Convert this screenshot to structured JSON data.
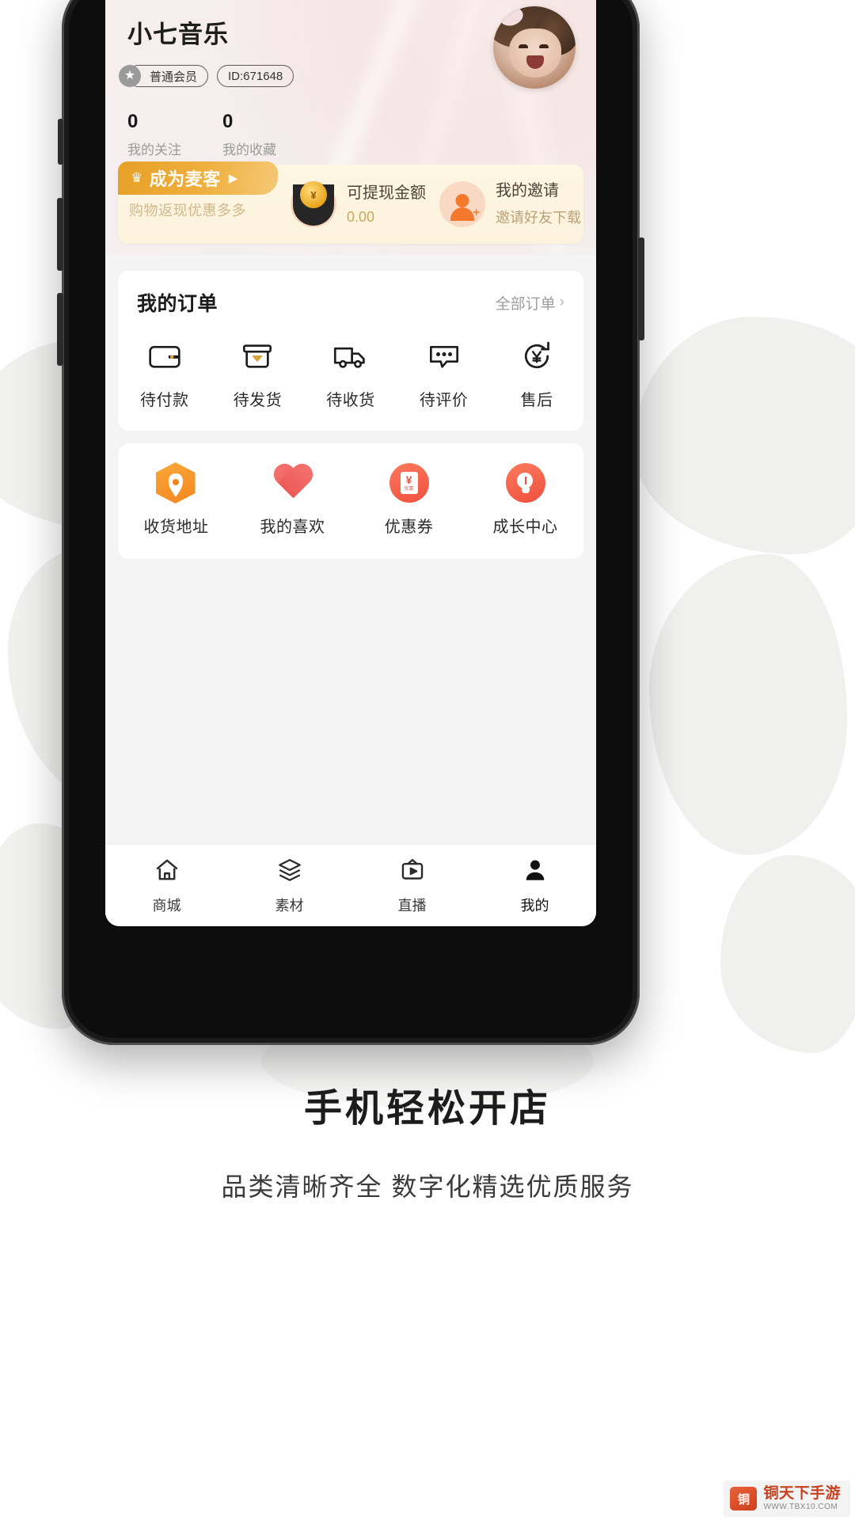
{
  "header": {
    "username": "小七音乐",
    "vip_badge": "普通会员",
    "id_badge": "ID:671648",
    "stats": [
      {
        "value": "0",
        "label": "我的关注"
      },
      {
        "value": "0",
        "label": "我的收藏"
      }
    ]
  },
  "promo": {
    "tag_label": "成为麦客",
    "tag_arrow": "▶",
    "subtitle": "购物返现优惠多多",
    "cells": [
      {
        "title": "可提现金额",
        "value": "0.00"
      },
      {
        "title": "我的邀请",
        "value": "邀请好友下载"
      }
    ]
  },
  "orders": {
    "title": "我的订单",
    "more_label": "全部订单",
    "more_chevron": "›",
    "items": [
      {
        "label": "待付款",
        "icon": "wallet-icon"
      },
      {
        "label": "待发货",
        "icon": "package-icon"
      },
      {
        "label": "待收货",
        "icon": "truck-icon"
      },
      {
        "label": "待评价",
        "icon": "comment-icon"
      },
      {
        "label": "售后",
        "icon": "refund-icon"
      }
    ]
  },
  "tools": {
    "items": [
      {
        "label": "收货地址",
        "icon": "location-pin-icon"
      },
      {
        "label": "我的喜欢",
        "icon": "heart-icon"
      },
      {
        "label": "优惠券",
        "icon": "coupon-icon",
        "note_symbol": "¥",
        "note_text": "优惠"
      },
      {
        "label": "成长中心",
        "icon": "lightbulb-icon"
      }
    ]
  },
  "tabbar": {
    "items": [
      {
        "label": "商城",
        "icon": "home-icon",
        "active": false
      },
      {
        "label": "素材",
        "icon": "layers-icon",
        "active": false
      },
      {
        "label": "直播",
        "icon": "live-tv-icon",
        "active": false
      },
      {
        "label": "我的",
        "icon": "person-icon",
        "active": true
      }
    ]
  },
  "footer": {
    "title": "手机轻松开店",
    "subtitle": "品类清晰齐全 数字化精选优质服务"
  },
  "watermark": {
    "logo_text": "铜",
    "name": "铜天下手游",
    "url": "WWW.TBX10.COM"
  },
  "colors": {
    "accent_orange": "#f4861f",
    "accent_red": "#ec5a57",
    "promo_bg": "#fdf6e2",
    "promo_tag": "#e7a027",
    "watermark_red": "#c63f1e"
  }
}
